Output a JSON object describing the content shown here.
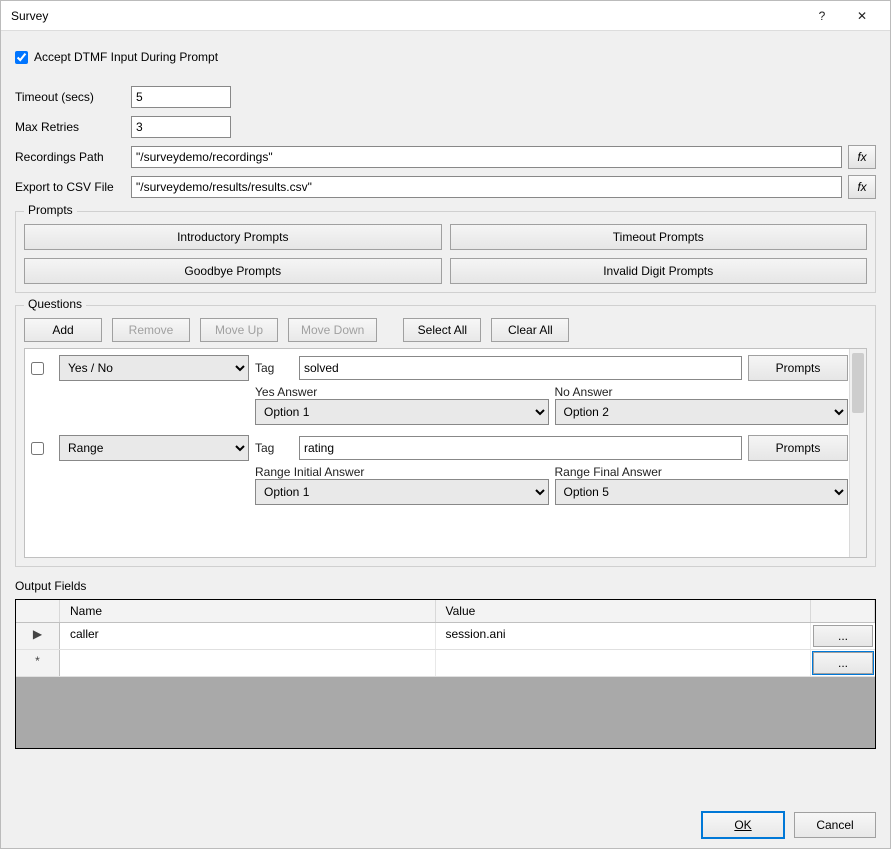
{
  "title": "Survey",
  "checkbox": {
    "label": "Accept DTMF Input During Prompt",
    "checked": true
  },
  "fields": {
    "timeout_label": "Timeout (secs)",
    "timeout_value": "5",
    "retries_label": "Max Retries",
    "retries_value": "3",
    "recpath_label": "Recordings Path",
    "recpath_value": "\"/surveydemo/recordings\"",
    "csv_label": "Export to CSV File",
    "csv_value": "\"/surveydemo/results/results.csv\"",
    "fx_label": "fx"
  },
  "prompts": {
    "legend": "Prompts",
    "intro": "Introductory Prompts",
    "timeout": "Timeout Prompts",
    "goodbye": "Goodbye Prompts",
    "invalid": "Invalid Digit Prompts"
  },
  "questions": {
    "legend": "Questions",
    "toolbar": {
      "add": "Add",
      "remove": "Remove",
      "moveup": "Move Up",
      "movedown": "Move Down",
      "selectall": "Select All",
      "clearall": "Clear All"
    },
    "tag_label": "Tag",
    "prompts_btn": "Prompts",
    "items": [
      {
        "type": "Yes / No",
        "tag": "solved",
        "left_label": "Yes Answer",
        "left_value": "Option 1",
        "right_label": "No Answer",
        "right_value": "Option 2"
      },
      {
        "type": "Range",
        "tag": "rating",
        "left_label": "Range Initial Answer",
        "left_value": "Option 1",
        "right_label": "Range Final Answer",
        "right_value": "Option 5"
      }
    ]
  },
  "output": {
    "label": "Output Fields",
    "cols": {
      "name": "Name",
      "value": "Value"
    },
    "rows": [
      {
        "marker": "▶",
        "name": "caller",
        "value": "session.ani",
        "btn": "..."
      },
      {
        "marker": "*",
        "name": "",
        "value": "",
        "btn": "..."
      }
    ]
  },
  "footer": {
    "ok": "OK",
    "cancel": "Cancel"
  }
}
